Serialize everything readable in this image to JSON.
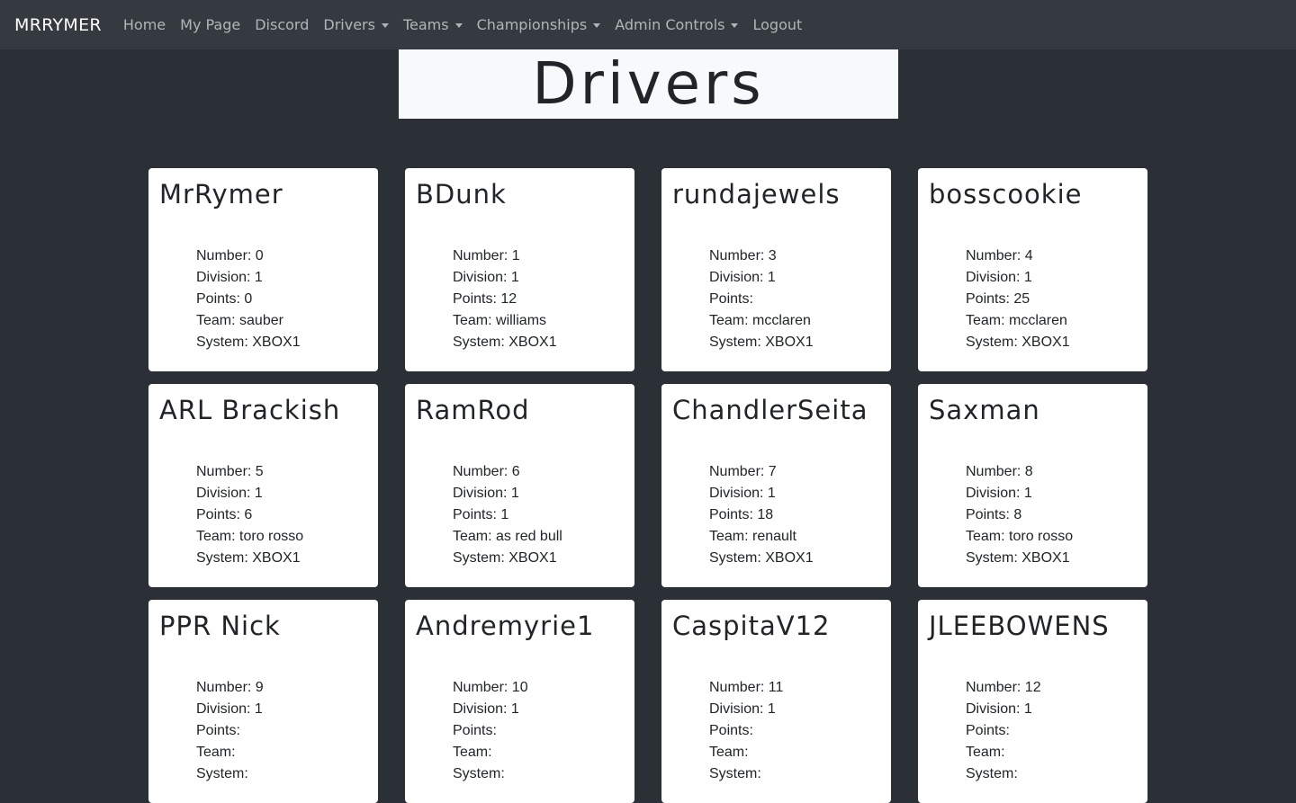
{
  "nav": {
    "brand": "MRRYMER",
    "items": [
      {
        "label": "Home",
        "dropdown": false
      },
      {
        "label": "My Page",
        "dropdown": false
      },
      {
        "label": "Discord",
        "dropdown": false
      },
      {
        "label": "Drivers",
        "dropdown": true
      },
      {
        "label": "Teams",
        "dropdown": true
      },
      {
        "label": "Championships",
        "dropdown": true
      },
      {
        "label": "Admin Controls",
        "dropdown": true
      },
      {
        "label": "Logout",
        "dropdown": false
      }
    ]
  },
  "page": {
    "title": "Drivers"
  },
  "labels": {
    "number": "Number: ",
    "division": "Division: ",
    "points": "Points: ",
    "team": "Team: ",
    "system": "System: "
  },
  "drivers": [
    {
      "name": "MrRymer",
      "number": "0",
      "division": "1",
      "points": "0",
      "team": "sauber",
      "system": "XBOX1"
    },
    {
      "name": "BDunk",
      "number": "1",
      "division": "1",
      "points": "12",
      "team": "williams",
      "system": "XBOX1"
    },
    {
      "name": "rundajewels",
      "number": "3",
      "division": "1",
      "points": "",
      "team": "mcclaren",
      "system": "XBOX1"
    },
    {
      "name": "bosscookie",
      "number": "4",
      "division": "1",
      "points": "25",
      "team": "mcclaren",
      "system": "XBOX1"
    },
    {
      "name": "ARL Brackish",
      "number": "5",
      "division": "1",
      "points": "6",
      "team": "toro rosso",
      "system": "XBOX1"
    },
    {
      "name": "RamRod",
      "number": "6",
      "division": "1",
      "points": "1",
      "team": "as red bull",
      "system": "XBOX1"
    },
    {
      "name": "ChandlerSeita",
      "number": "7",
      "division": "1",
      "points": "18",
      "team": "renault",
      "system": "XBOX1"
    },
    {
      "name": "Saxman",
      "number": "8",
      "division": "1",
      "points": "8",
      "team": "toro rosso",
      "system": "XBOX1"
    },
    {
      "name": "PPR Nick",
      "number": "9",
      "division": "1",
      "points": "",
      "team": "",
      "system": ""
    },
    {
      "name": "Andremyrie1",
      "number": "10",
      "division": "1",
      "points": "",
      "team": "",
      "system": ""
    },
    {
      "name": "CaspitaV12",
      "number": "11",
      "division": "1",
      "points": "",
      "team": "",
      "system": ""
    },
    {
      "name": "JLEEBOWENS",
      "number": "12",
      "division": "1",
      "points": "",
      "team": "",
      "system": ""
    }
  ]
}
